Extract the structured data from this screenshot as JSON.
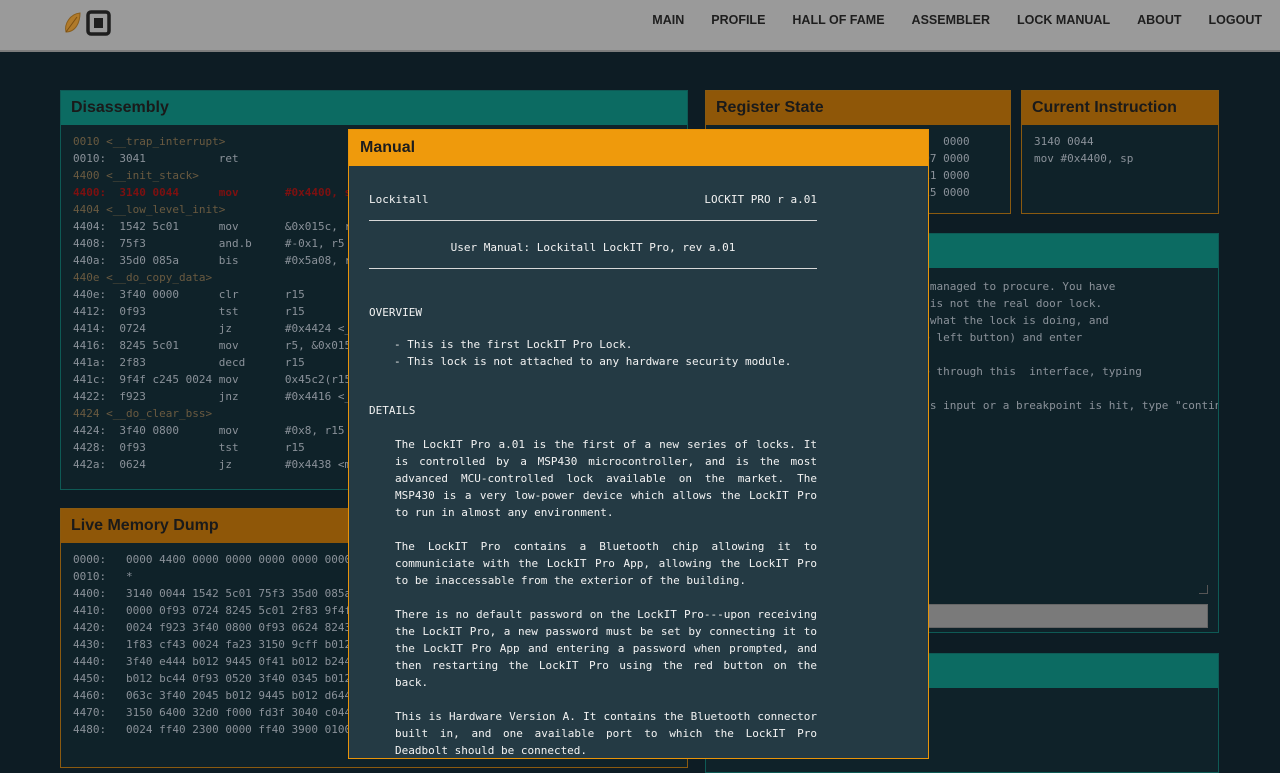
{
  "nav": [
    "MAIN",
    "PROFILE",
    "HALL OF FAME",
    "ASSEMBLER",
    "LOCK MANUAL",
    "ABOUT",
    "LOGOUT"
  ],
  "disassembly": {
    "title": "Disassembly",
    "lines": [
      {
        "text": "0010 <__trap_interrupt>",
        "kind": "label"
      },
      {
        "text": "0010:  3041           ret",
        "kind": "normal"
      },
      {
        "text": "4400 <__init_stack>",
        "kind": "label"
      },
      {
        "text": "4400:  3140 0044      mov       #0x4400, sp",
        "kind": "cur"
      },
      {
        "text": "4404 <__low_level_init>",
        "kind": "label"
      },
      {
        "text": "4404:  1542 5c01      mov       &0x015c, r5",
        "kind": "normal"
      },
      {
        "text": "4408:  75f3           and.b     #-0x1, r5",
        "kind": "normal"
      },
      {
        "text": "440a:  35d0 085a      bis       #0x5a08, r5",
        "kind": "normal"
      },
      {
        "text": "440e <__do_copy_data>",
        "kind": "label"
      },
      {
        "text": "440e:  3f40 0000      clr       r15",
        "kind": "normal"
      },
      {
        "text": "4412:  0f93           tst       r15",
        "kind": "normal"
      },
      {
        "text": "4414:  0724           jz        #0x4424 <__do_clear_bss>",
        "kind": "normal"
      },
      {
        "text": "4416:  8245 5c01      mov       r5, &0x015c",
        "kind": "normal"
      },
      {
        "text": "441a:  2f83           decd      r15",
        "kind": "normal"
      },
      {
        "text": "441c:  9f4f c245 0024 mov       0x45c2(r15), 0x2400(r15)",
        "kind": "normal"
      },
      {
        "text": "4422:  f923           jnz       #0x4416 <__do_copy_data+0x8>",
        "kind": "normal"
      },
      {
        "text": "4424 <__do_clear_bss>",
        "kind": "label"
      },
      {
        "text": "4424:  3f40 0800      mov       #0x8, r15",
        "kind": "normal"
      },
      {
        "text": "4428:  0f93           tst       r15",
        "kind": "normal"
      },
      {
        "text": "442a:  0624           jz        #0x4438 <main>",
        "kind": "normal"
      }
    ]
  },
  "register": {
    "title": "Register State",
    "lines": [
      "pc  4400  sp  0000  sr  0000  cg  0000",
      "r04 0000  r05 5a08  r06 0000  r07 0000",
      "r08 0000  r09 0000  r10 0000  r11 0000",
      "r12 0000  r13 0000  r14 0000  r15 0000"
    ]
  },
  "current": {
    "title": "Current Instruction",
    "lines": [
      "3140 0044",
      "mov #0x4400, sp"
    ]
  },
  "console": {
    "lines": [
      "Welcome to the debugger. You've managed to procure. You have",
      "unlocked a device. Note that it is not the real door lock.",
      "You can use the debugger to see what the lock is doing, and",
      "then use the Solve function (the left button) and enter",
      "",
      "You can interact with the device through this  interface, typing",
      "",
      "To run the program until it needs input or a breakpoint is hit, type \"continue\"."
    ]
  },
  "memory": {
    "title": "Live Memory Dump",
    "lines": [
      "0000:   0000 4400 0000 0000 0000 0000 0000 0000",
      "0010:   *",
      "4400:   3140 0044 1542 5c01 75f3 35d0 085a 3f40",
      "4410:   0000 0f93 0724 8245 5c01 2f83 9f4f c245",
      "4420:   0024 f923 3f40 0800 0f93 0624 8243 0024",
      "4430:   1f83 cf43 0024 fa23 3150 9cff b012 5c44",
      "4440:   3f40 e444 b012 9445 0f41 b012 b244 0f93",
      "4450:   b012 bc44 0f93 0520 3f40 0345 b012 9445",
      "4460:   063c 3f40 2045 b012 9445 b012 d644 3041",
      "4470:   3150 6400 32d0 f000 fd3f 3040 c044 3041",
      "4480:   0024 ff40 2300 0000 ff40 3900 0100 3041"
    ]
  },
  "manual": {
    "title": "Manual",
    "left_head": "Lockitall",
    "right_head": "LOCKIT PRO r a.01",
    "subtitle": "User Manual: Lockitall LockIT Pro, rev a.01",
    "overview_title": "OVERVIEW",
    "bullets": [
      "- This is the first LockIT Pro Lock.",
      "- This lock is not attached to any hardware security module."
    ],
    "details_title": "DETAILS",
    "paragraphs": [
      "The LockIT Pro a.01  is the first of a new series  of locks. It is controlled by a  MSP430 microcontroller, and is  the most advanced MCU-controlled lock available on the  market. The MSP430 is a very low-power device which allows the LockIT  Pro to run in almost any environment.",
      "The  LockIT Pro  contains  a  Bluetooth  chip  allowing  it  to communiciate with the  LockIT Pro App, allowing the  LockIT Pro to be inaccessable from the exterior of the building.",
      "There is  no default password  on the LockIT  Pro---upon receiving the LockIT Pro, a new password must be set by connecting it to the LockIT Pro  App and  entering a password  when prompted,  and then restarting the LockIT Pro using the red button on the back.",
      "This is Hardware  Version A.  It contains  the Bluetooth connector built in, and one available port  to which the LockIT Pro Deadbolt should be connected."
    ]
  }
}
